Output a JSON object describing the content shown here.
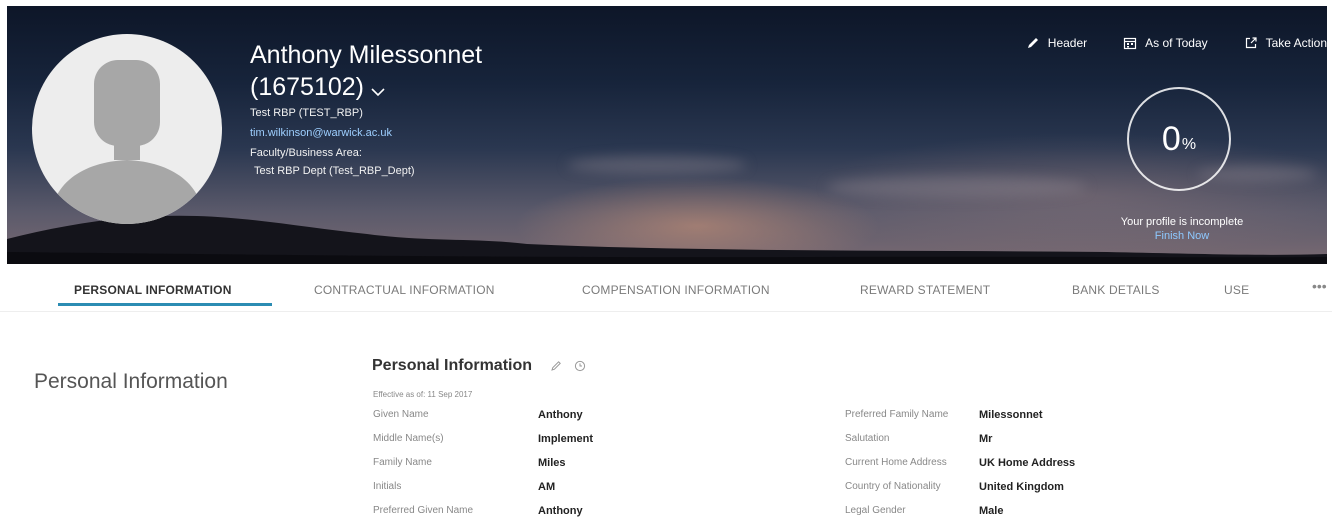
{
  "profile": {
    "name": "Anthony Milessonnet",
    "id": "(1675102)",
    "role": "Test RBP (TEST_RBP)",
    "email": "tim.wilkinson@warwick.ac.uk",
    "area_label": "Faculty/Business Area:",
    "area_value": "Test RBP Dept (Test_RBP_Dept)"
  },
  "header_actions": [
    {
      "label": "Header",
      "icon": "pencil-icon"
    },
    {
      "label": "As of Today",
      "icon": "calendar-icon"
    },
    {
      "label": "Take Action",
      "icon": "external-link-icon"
    }
  ],
  "completion": {
    "value": "0",
    "unit": "%",
    "message": "Your profile is incomplete",
    "link": "Finish Now"
  },
  "tabs": [
    {
      "label": "PERSONAL INFORMATION",
      "active": true
    },
    {
      "label": "CONTRACTUAL INFORMATION",
      "active": false
    },
    {
      "label": "COMPENSATION INFORMATION",
      "active": false
    },
    {
      "label": "REWARD STATEMENT",
      "active": false
    },
    {
      "label": "BANK DETAILS",
      "active": false
    },
    {
      "label": "USE",
      "active": false
    }
  ],
  "tabs_more": "•••",
  "section": {
    "title": "Personal Information",
    "card_title": "Personal Information",
    "effective": "Effective as of: 11 Sep 2017"
  },
  "fields_left": [
    {
      "label": "Given Name",
      "value": "Anthony"
    },
    {
      "label": "Middle Name(s)",
      "value": "Implement"
    },
    {
      "label": "Family Name",
      "value": "Miles"
    },
    {
      "label": "Initials",
      "value": "AM"
    },
    {
      "label": "Preferred Given Name",
      "value": "Anthony"
    }
  ],
  "fields_right": [
    {
      "label": "Preferred Family Name",
      "value": "Milessonnet"
    },
    {
      "label": "Salutation",
      "value": "Mr"
    },
    {
      "label": "Current Home Address",
      "value": "UK Home Address"
    },
    {
      "label": "Country of Nationality",
      "value": "United Kingdom"
    },
    {
      "label": "Legal Gender",
      "value": "Male"
    }
  ],
  "colors": {
    "tab_accent": "#2b8cb3",
    "link": "#8ec9ff"
  }
}
